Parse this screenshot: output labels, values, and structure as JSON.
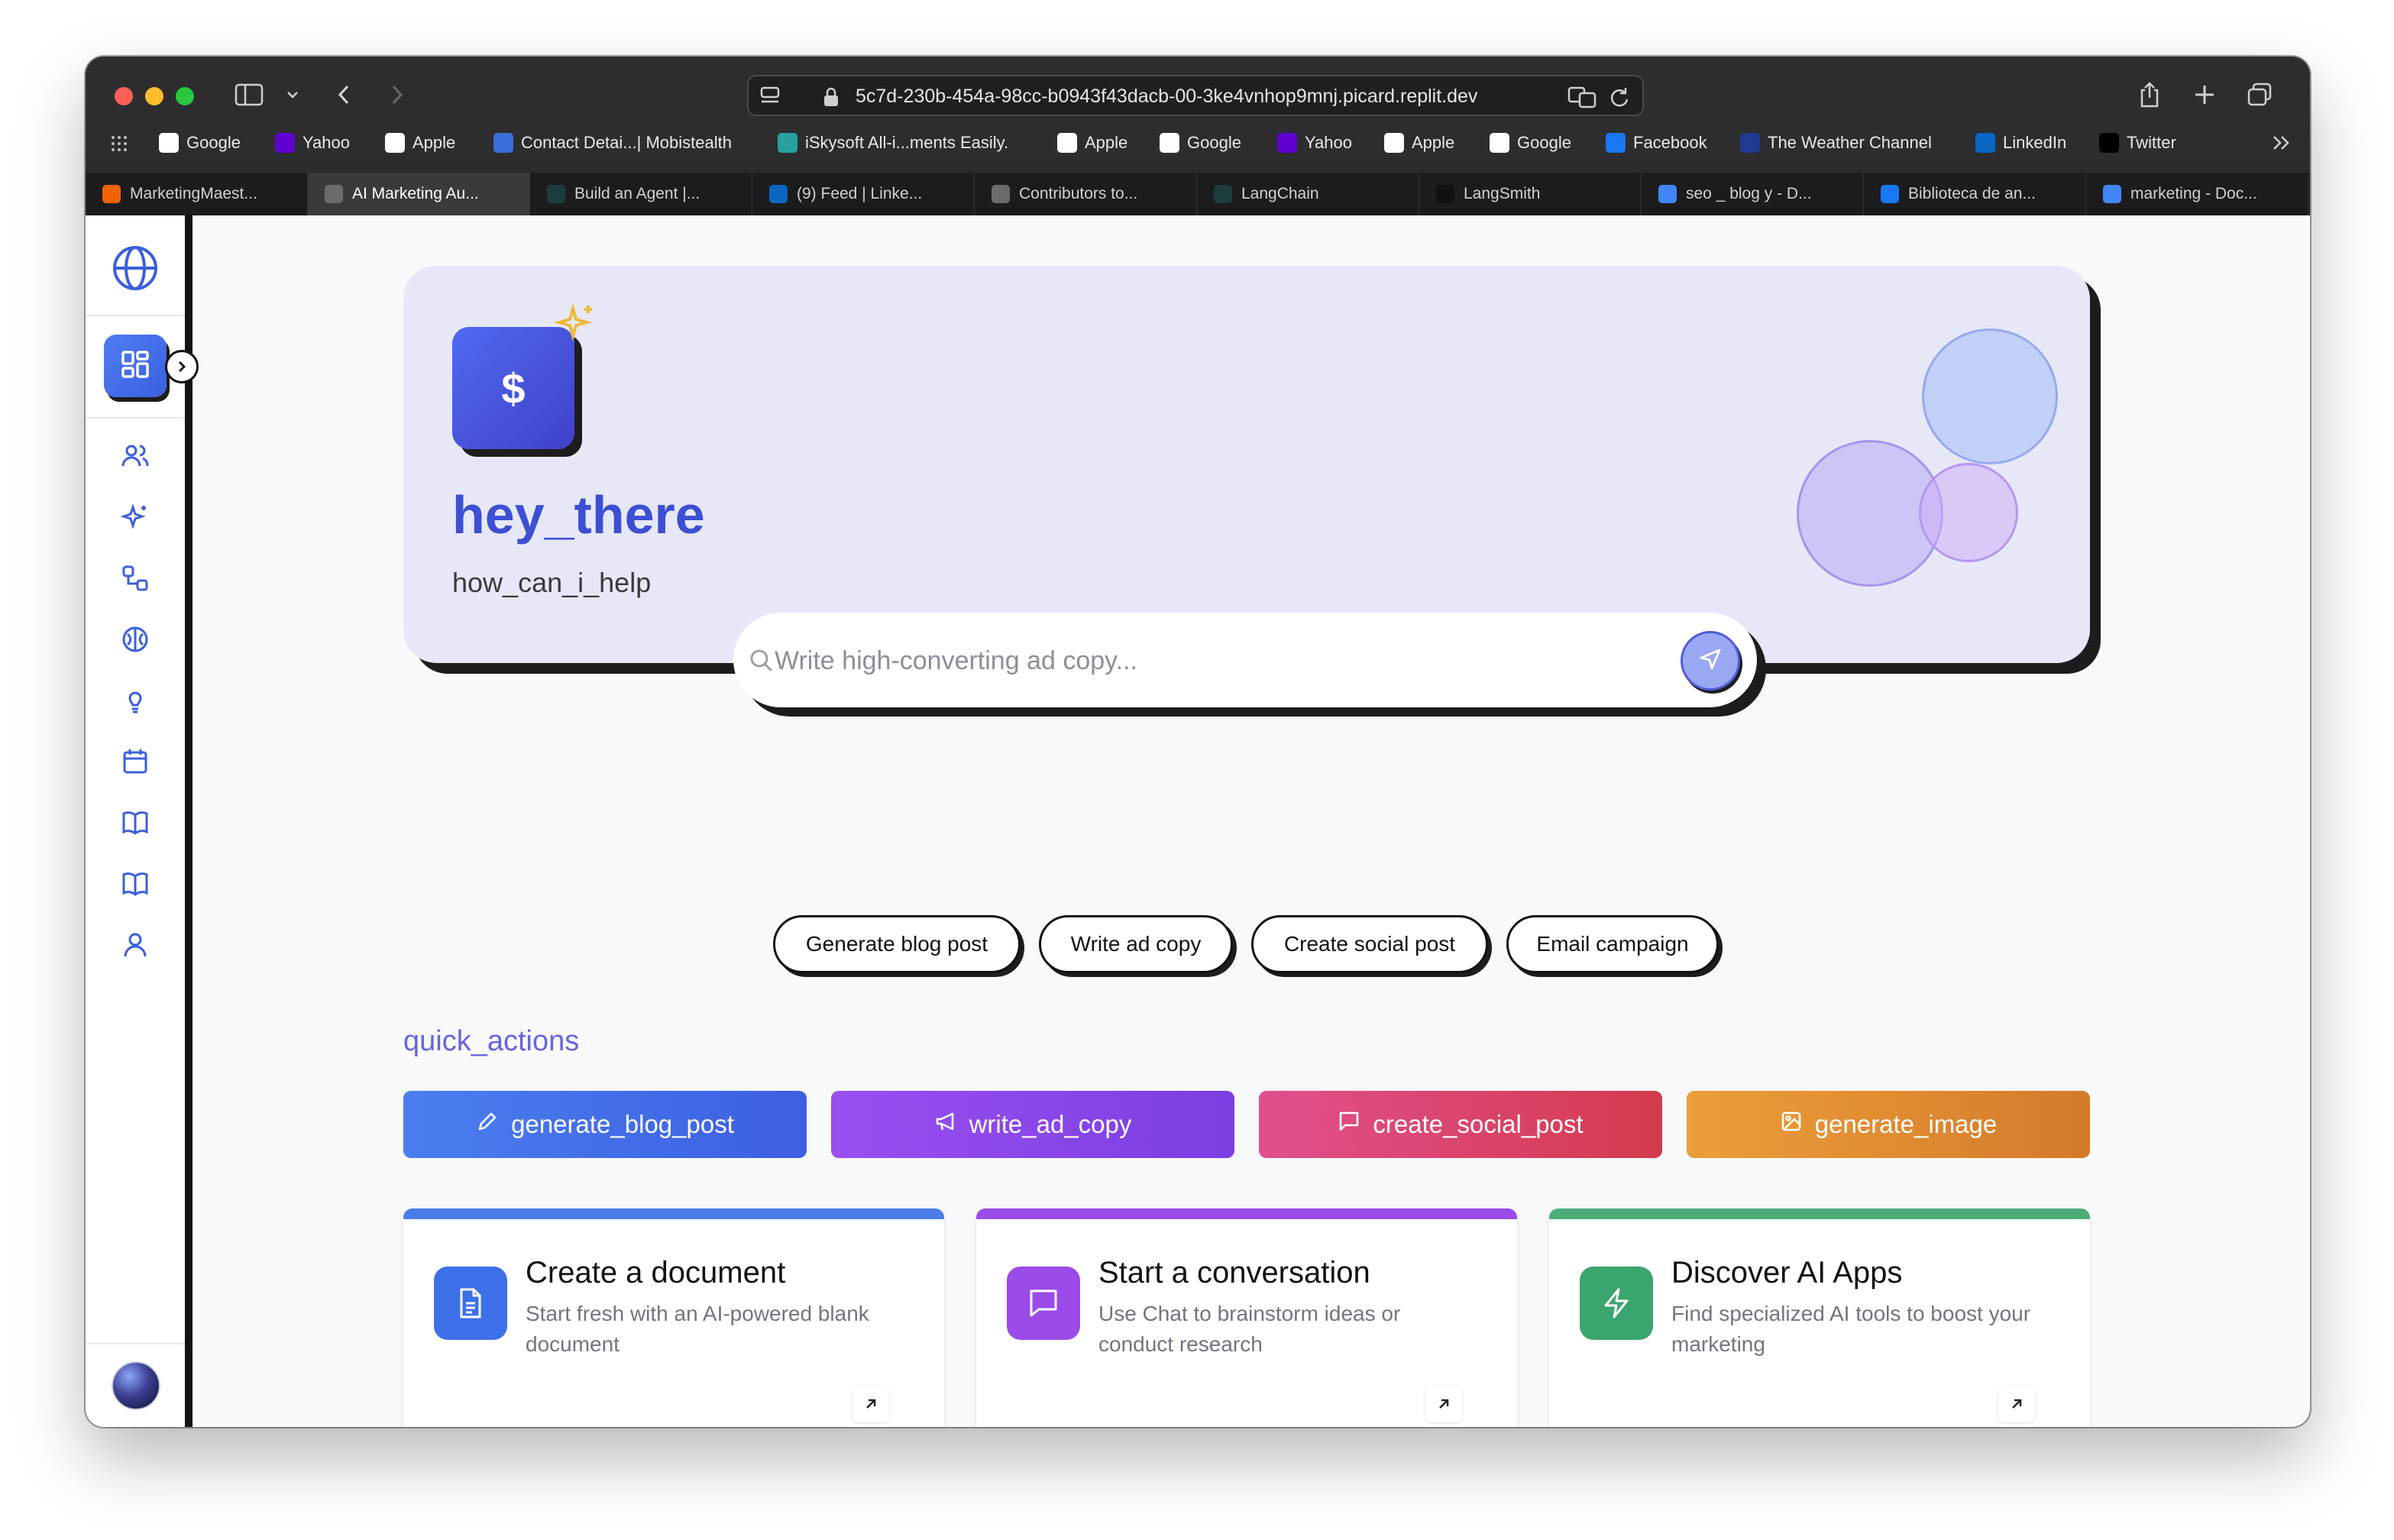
{
  "browser": {
    "url": "5c7d-230b-454a-98cc-b0943f43dacb-00-3ke4vnhop9mnj.picard.replit.dev",
    "bookmarks": [
      {
        "label": "Google",
        "icon": "google-icon",
        "color": "#ffffff"
      },
      {
        "label": "Yahoo",
        "icon": "yahoo-icon",
        "color": "#6001d2"
      },
      {
        "label": "Apple",
        "icon": "apple-icon",
        "color": "#ffffff"
      },
      {
        "label": "Contact Detai...| Mobistealth",
        "icon": "mobistealth-icon",
        "color": "#3a6fd8"
      },
      {
        "label": "iSkysoft All-i...ments Easily.",
        "icon": "iskysoft-icon",
        "color": "#28a0a0"
      },
      {
        "label": "Apple",
        "icon": "apple-icon",
        "color": "#ffffff"
      },
      {
        "label": "Google",
        "icon": "google-icon",
        "color": "#ffffff"
      },
      {
        "label": "Yahoo",
        "icon": "yahoo-icon",
        "color": "#6001d2"
      },
      {
        "label": "Apple",
        "icon": "apple-icon",
        "color": "#ffffff"
      },
      {
        "label": "Google",
        "icon": "google-icon",
        "color": "#ffffff"
      },
      {
        "label": "Facebook",
        "icon": "facebook-icon",
        "color": "#1877f2"
      },
      {
        "label": "The Weather Channel",
        "icon": "weather-channel-icon",
        "color": "#1f3a8f"
      },
      {
        "label": "LinkedIn",
        "icon": "linkedin-icon",
        "color": "#0a66c2"
      },
      {
        "label": "Twitter",
        "icon": "x-icon",
        "color": "#000000"
      }
    ],
    "tabs": [
      {
        "label": "MarketingMaest...",
        "icon": "replit-icon",
        "color": "#f26207"
      },
      {
        "label": "AI Marketing Au...",
        "icon": "r-icon",
        "color": "#6b6b6e"
      },
      {
        "label": "Build an Agent |...",
        "icon": "langchain-icon",
        "color": "#1c3c3c"
      },
      {
        "label": "(9) Feed | Linke...",
        "icon": "linkedin-icon",
        "color": "#0a66c2"
      },
      {
        "label": "Contributors to...",
        "icon": "g-icon",
        "color": "#6b6b6e"
      },
      {
        "label": "LangChain",
        "icon": "langchain-icon",
        "color": "#1c3c3c"
      },
      {
        "label": "LangSmith",
        "icon": "langsmith-icon",
        "color": "#111111"
      },
      {
        "label": "seo _ blog y - D...",
        "icon": "docs-icon",
        "color": "#4285f4"
      },
      {
        "label": "Biblioteca de an...",
        "icon": "facebook-icon",
        "color": "#1877f2"
      },
      {
        "label": "marketing - Doc...",
        "icon": "docs-icon",
        "color": "#4285f4"
      }
    ]
  },
  "hero": {
    "logo_symbol": "$",
    "title": "hey_there",
    "subtitle": "how_can_i_help"
  },
  "search": {
    "placeholder": "Write high-converting ad copy..."
  },
  "suggestions": [
    "Generate blog post",
    "Write ad copy",
    "Create social post",
    "Email campaign"
  ],
  "quick_actions": {
    "title": "quick_actions",
    "items": [
      {
        "label": "generate_blog_post",
        "icon": "pencil-icon",
        "color_from": "#4b7ef0",
        "color_to": "#3d5fe0"
      },
      {
        "label": "write_ad_copy",
        "icon": "megaphone-icon",
        "color_from": "#9a4ff0",
        "color_to": "#7b3ee0"
      },
      {
        "label": "create_social_post",
        "icon": "message-icon",
        "color_from": "#e0508e",
        "color_to": "#d43a4e"
      },
      {
        "label": "generate_image",
        "icon": "image-icon",
        "color_from": "#ec9e3a",
        "color_to": "#d47a2a"
      }
    ]
  },
  "cards": [
    {
      "title": "Create a document",
      "description": "Start fresh with an AI-powered blank document",
      "icon": "document-icon",
      "color": "#3d6fe8",
      "bar": "#4a7de8"
    },
    {
      "title": "Start a conversation",
      "description": "Use Chat to brainstorm ideas or conduct research",
      "icon": "chat-icon",
      "color": "#9a4be8",
      "bar": "#9a4be8"
    },
    {
      "title": "Discover AI Apps",
      "description": "Find specialized AI tools to boost your marketing",
      "icon": "lightning-icon",
      "color": "#3aa56e",
      "bar": "#4cad7a"
    }
  ],
  "sidebar": {
    "items": [
      "logo-globe-icon",
      "dashboard-icon",
      "users-icon",
      "sparkles-icon",
      "workflow-icon",
      "brain-icon",
      "lightbulb-icon",
      "calendar-icon",
      "book-icon",
      "book-open-icon",
      "user-icon"
    ]
  }
}
